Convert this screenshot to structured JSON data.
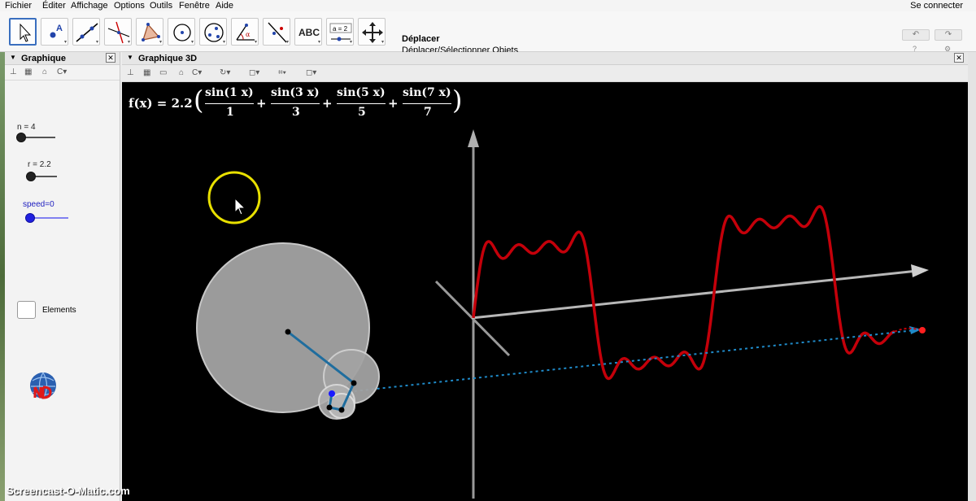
{
  "menu": {
    "items": [
      "Fichier",
      "Éditer",
      "Affichage",
      "Options",
      "Outils",
      "Fenêtre",
      "Aide"
    ],
    "login": "Se connecter"
  },
  "toolbar": {
    "tools": [
      {
        "name": "move-tool",
        "icon": "arrow-cursor-icon"
      },
      {
        "name": "point-tool",
        "icon": "point-icon"
      },
      {
        "name": "line-tool",
        "icon": "line-icon"
      },
      {
        "name": "perpendicular-tool",
        "icon": "perpendicular-icon"
      },
      {
        "name": "polygon-tool",
        "icon": "triangle-icon"
      },
      {
        "name": "circle-tool",
        "icon": "circle-icon"
      },
      {
        "name": "conic-tool",
        "icon": "ellipse-icon"
      },
      {
        "name": "angle-tool",
        "icon": "angle-icon"
      },
      {
        "name": "reflect-tool",
        "icon": "reflect-icon"
      },
      {
        "name": "text-tool",
        "icon": "text-icon",
        "label": "ABC"
      },
      {
        "name": "slider-tool",
        "icon": "slider-icon",
        "label": "a = 2"
      },
      {
        "name": "move-view-tool",
        "icon": "move-view-icon"
      }
    ],
    "selected_title": "Déplacer",
    "selected_desc": "Déplacer/Sélectionner Objets"
  },
  "graphics_panel": {
    "title": "Graphique",
    "sliders": [
      {
        "label": "n = 4",
        "value": 4
      },
      {
        "label": "r = 2.2",
        "value": 2.2
      },
      {
        "label": "speed=0",
        "value": 0
      }
    ],
    "checkbox_label": "Elements"
  },
  "view3d": {
    "title": "Graphique 3D",
    "formula": {
      "lhs": "f(x) = 2.2",
      "terms": [
        {
          "num": "sin(1 x)",
          "den": "1"
        },
        {
          "num": "sin(3 x)",
          "den": "3"
        },
        {
          "num": "sin(5 x)",
          "den": "5"
        },
        {
          "num": "sin(7 x)",
          "den": "7"
        }
      ],
      "operator": "+"
    }
  },
  "colors": {
    "curve": "#c4000a",
    "arm": "#1f6d9e",
    "highlight": "#e8e000",
    "disk": "#9a9a9a"
  },
  "watermark": "Screencast-O-Matic.com"
}
